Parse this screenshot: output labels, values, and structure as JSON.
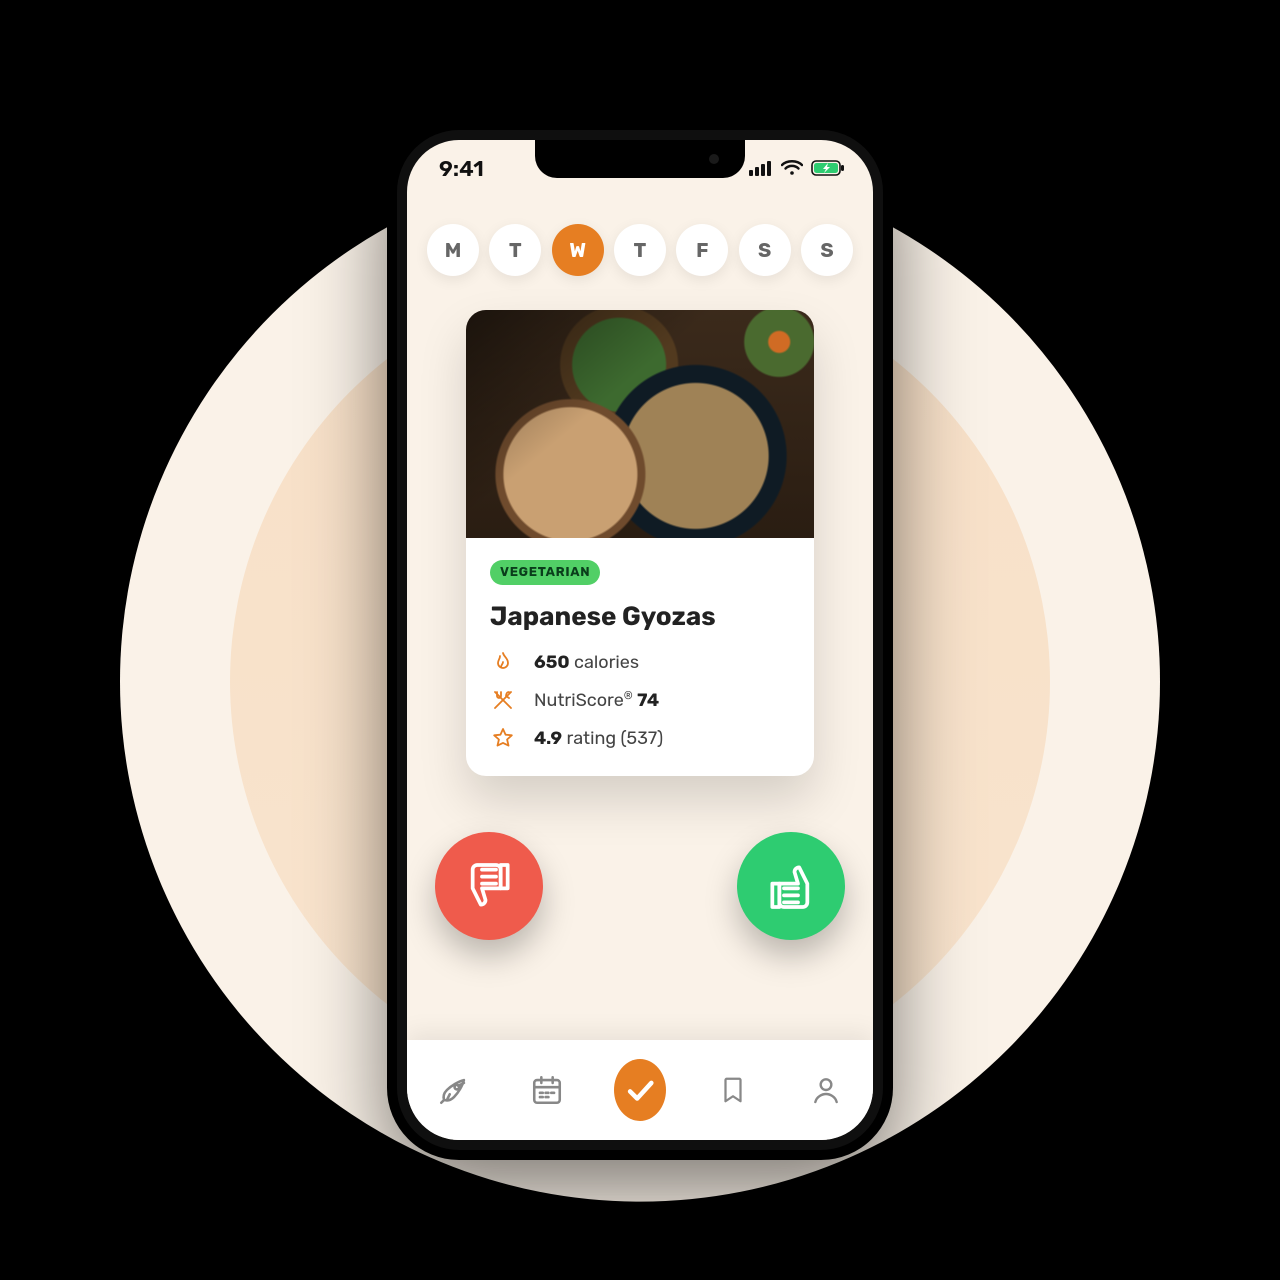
{
  "status_bar": {
    "time": "9:41"
  },
  "week": {
    "days": [
      {
        "label": "M",
        "selected": false
      },
      {
        "label": "T",
        "selected": false
      },
      {
        "label": "W",
        "selected": true
      },
      {
        "label": "T",
        "selected": false
      },
      {
        "label": "F",
        "selected": false
      },
      {
        "label": "S",
        "selected": false
      },
      {
        "label": "S",
        "selected": false
      }
    ]
  },
  "meal": {
    "badge": "VEGETARIAN",
    "title": "Japanese Gyozas",
    "calories_value": "650",
    "calories_unit": "calories",
    "nutriscore_label": "NutriScore",
    "nutriscore_reg": "®",
    "nutriscore_value": "74",
    "rating_value": "4.9",
    "rating_word": "rating",
    "rating_count": "(537)"
  },
  "colors": {
    "accent": "#e67e22",
    "green": "#2ecc71",
    "red": "#ef5b4c",
    "badge": "#51cf66"
  }
}
